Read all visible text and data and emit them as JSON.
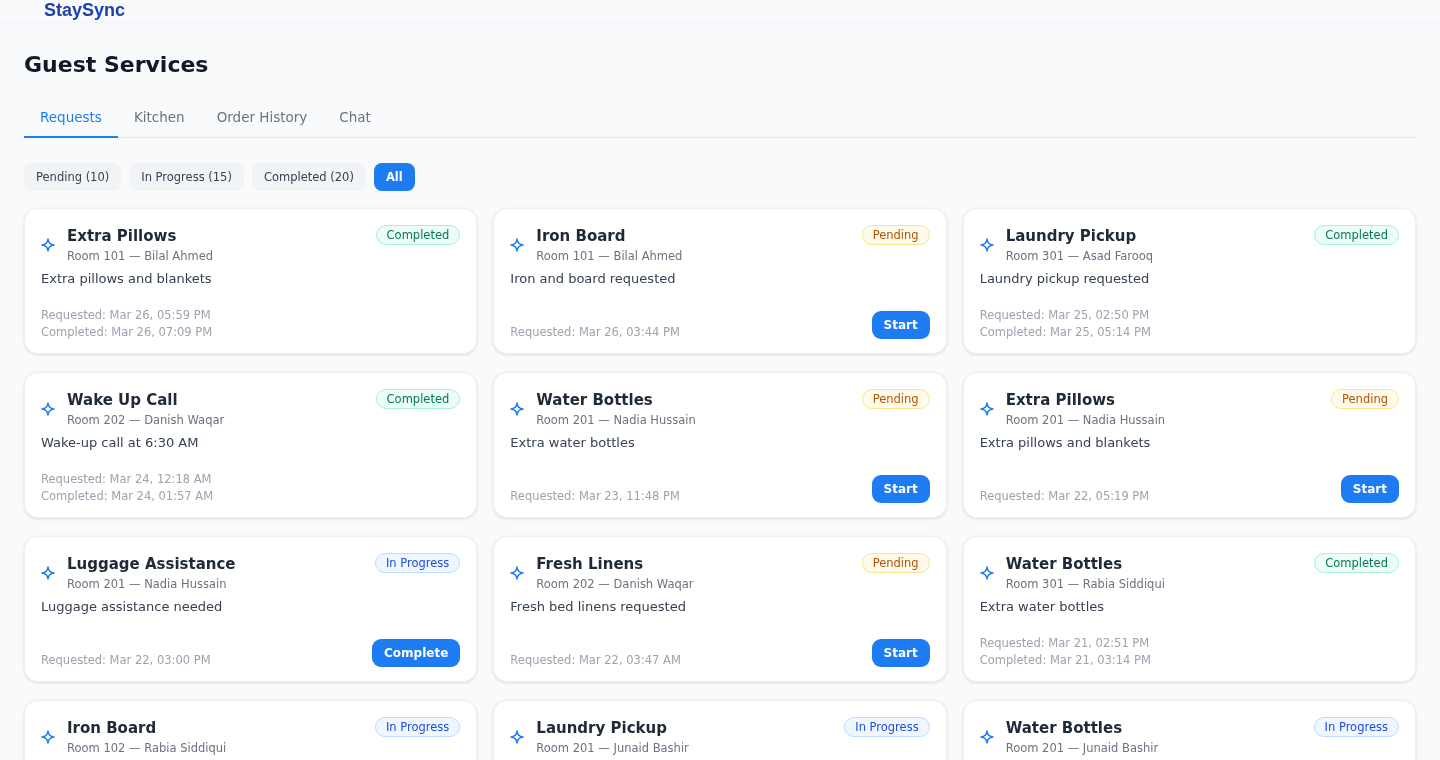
{
  "header": {
    "logo": "StaySync"
  },
  "page": {
    "title": "Guest Services"
  },
  "tabs": [
    {
      "label": "Requests",
      "selected": true
    },
    {
      "label": "Kitchen",
      "selected": false
    },
    {
      "label": "Order History",
      "selected": false
    },
    {
      "label": "Chat",
      "selected": false
    }
  ],
  "filters": [
    {
      "label": "Pending (10)",
      "selected": false
    },
    {
      "label": "In Progress (15)",
      "selected": false
    },
    {
      "label": "Completed (20)",
      "selected": false
    },
    {
      "label": "All",
      "selected": true
    }
  ],
  "requests": [
    {
      "title": "Extra Pillows",
      "room": "Room 101 — Bilal Ahmed",
      "status": {
        "kind": "completed",
        "label": "Completed"
      },
      "description": "Extra pillows and blankets",
      "times": [
        "Requested: Mar 26, 05:59 PM",
        "Completed: Mar 26, 07:09 PM"
      ]
    },
    {
      "title": "Iron Board",
      "room": "Room 101 — Bilal Ahmed",
      "status": {
        "kind": "pending",
        "label": "Pending"
      },
      "description": "Iron and board requested",
      "times": [
        "Requested: Mar 26, 03:44 PM"
      ],
      "action": "Start"
    },
    {
      "title": "Laundry Pickup",
      "room": "Room 301 — Asad Farooq",
      "status": {
        "kind": "completed",
        "label": "Completed"
      },
      "description": "Laundry pickup requested",
      "times": [
        "Requested: Mar 25, 02:50 PM",
        "Completed: Mar 25, 05:14 PM"
      ]
    },
    {
      "title": "Wake Up Call",
      "room": "Room 202 — Danish Waqar",
      "status": {
        "kind": "completed",
        "label": "Completed"
      },
      "description": "Wake-up call at 6:30 AM",
      "times": [
        "Requested: Mar 24, 12:18 AM",
        "Completed: Mar 24, 01:57 AM"
      ]
    },
    {
      "title": "Water Bottles",
      "room": "Room 201 — Nadia Hussain",
      "status": {
        "kind": "pending",
        "label": "Pending"
      },
      "description": "Extra water bottles",
      "times": [
        "Requested: Mar 23, 11:48 PM"
      ],
      "action": "Start"
    },
    {
      "title": "Extra Pillows",
      "room": "Room 201 — Nadia Hussain",
      "status": {
        "kind": "pending",
        "label": "Pending"
      },
      "description": "Extra pillows and blankets",
      "times": [
        "Requested: Mar 22, 05:19 PM"
      ],
      "action": "Start"
    },
    {
      "title": "Luggage Assistance",
      "room": "Room 201 — Nadia Hussain",
      "status": {
        "kind": "in_progress",
        "label": "In Progress"
      },
      "description": "Luggage assistance needed",
      "times": [
        "Requested: Mar 22, 03:00 PM"
      ],
      "action": "Complete"
    },
    {
      "title": "Fresh Linens",
      "room": "Room 202 — Danish Waqar",
      "status": {
        "kind": "pending",
        "label": "Pending"
      },
      "description": "Fresh bed linens requested",
      "times": [
        "Requested: Mar 22, 03:47 AM"
      ],
      "action": "Start"
    },
    {
      "title": "Water Bottles",
      "room": "Room 301 — Rabia Siddiqui",
      "status": {
        "kind": "completed",
        "label": "Completed"
      },
      "description": "Extra water bottles",
      "times": [
        "Requested: Mar 21, 02:51 PM",
        "Completed: Mar 21, 03:14 PM"
      ]
    },
    {
      "title": "Iron Board",
      "room": "Room 102 — Rabia Siddiqui",
      "status": {
        "kind": "in_progress",
        "label": "In Progress"
      }
    },
    {
      "title": "Laundry Pickup",
      "room": "Room 201 — Junaid Bashir",
      "status": {
        "kind": "in_progress",
        "label": "In Progress"
      }
    },
    {
      "title": "Water Bottles",
      "room": "Room 201 — Junaid Bashir",
      "status": {
        "kind": "in_progress",
        "label": "In Progress"
      }
    }
  ]
}
